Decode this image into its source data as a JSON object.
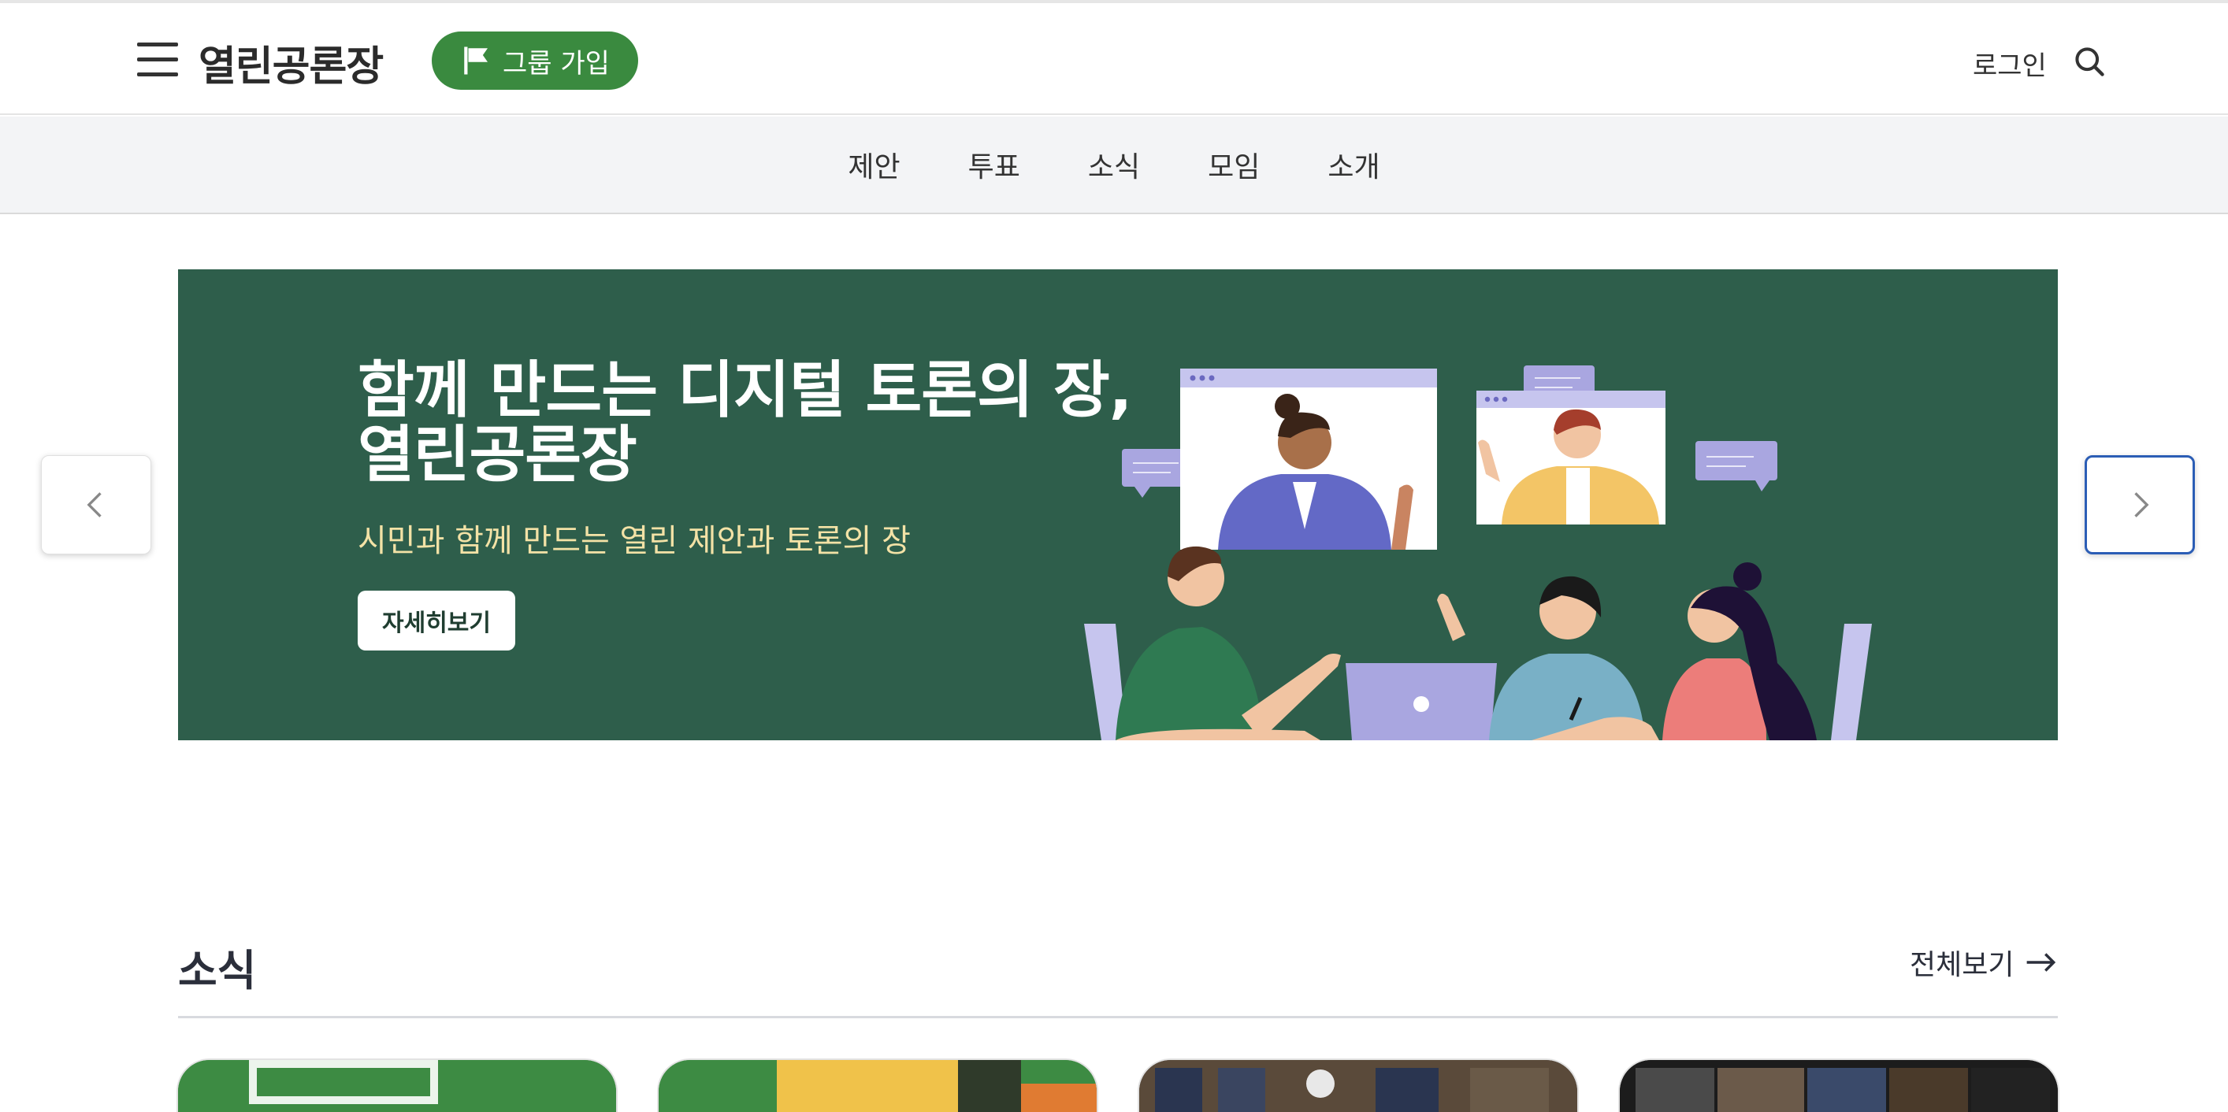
{
  "header": {
    "brand": "열린공론장",
    "join_label": "그룹 가입",
    "login_label": "로그인",
    "icons": {
      "menu": "hamburger-menu-icon",
      "join": "flag-icon",
      "search": "search-icon"
    },
    "colors": {
      "join_bg": "#3a8a3f"
    }
  },
  "nav": {
    "items": [
      {
        "label": "제안"
      },
      {
        "label": "투표"
      },
      {
        "label": "소식"
      },
      {
        "label": "모임"
      },
      {
        "label": "소개"
      }
    ]
  },
  "hero": {
    "title_line1": "함께 만드는 디지털 토론의 장,",
    "title_line2": "열린공론장",
    "subtitle": "시민과 함께 만드는 열린 제안과 토론의 장",
    "button_label": "자세히보기",
    "colors": {
      "background": "#2e5e4b",
      "subtitle": "#f3e2a6"
    },
    "icons": {
      "prev": "chevron-left-icon",
      "next": "chevron-right-icon"
    }
  },
  "news": {
    "title": "소식",
    "see_all_label": "전체보기",
    "icons": {
      "see_all": "arrow-right-icon"
    }
  }
}
